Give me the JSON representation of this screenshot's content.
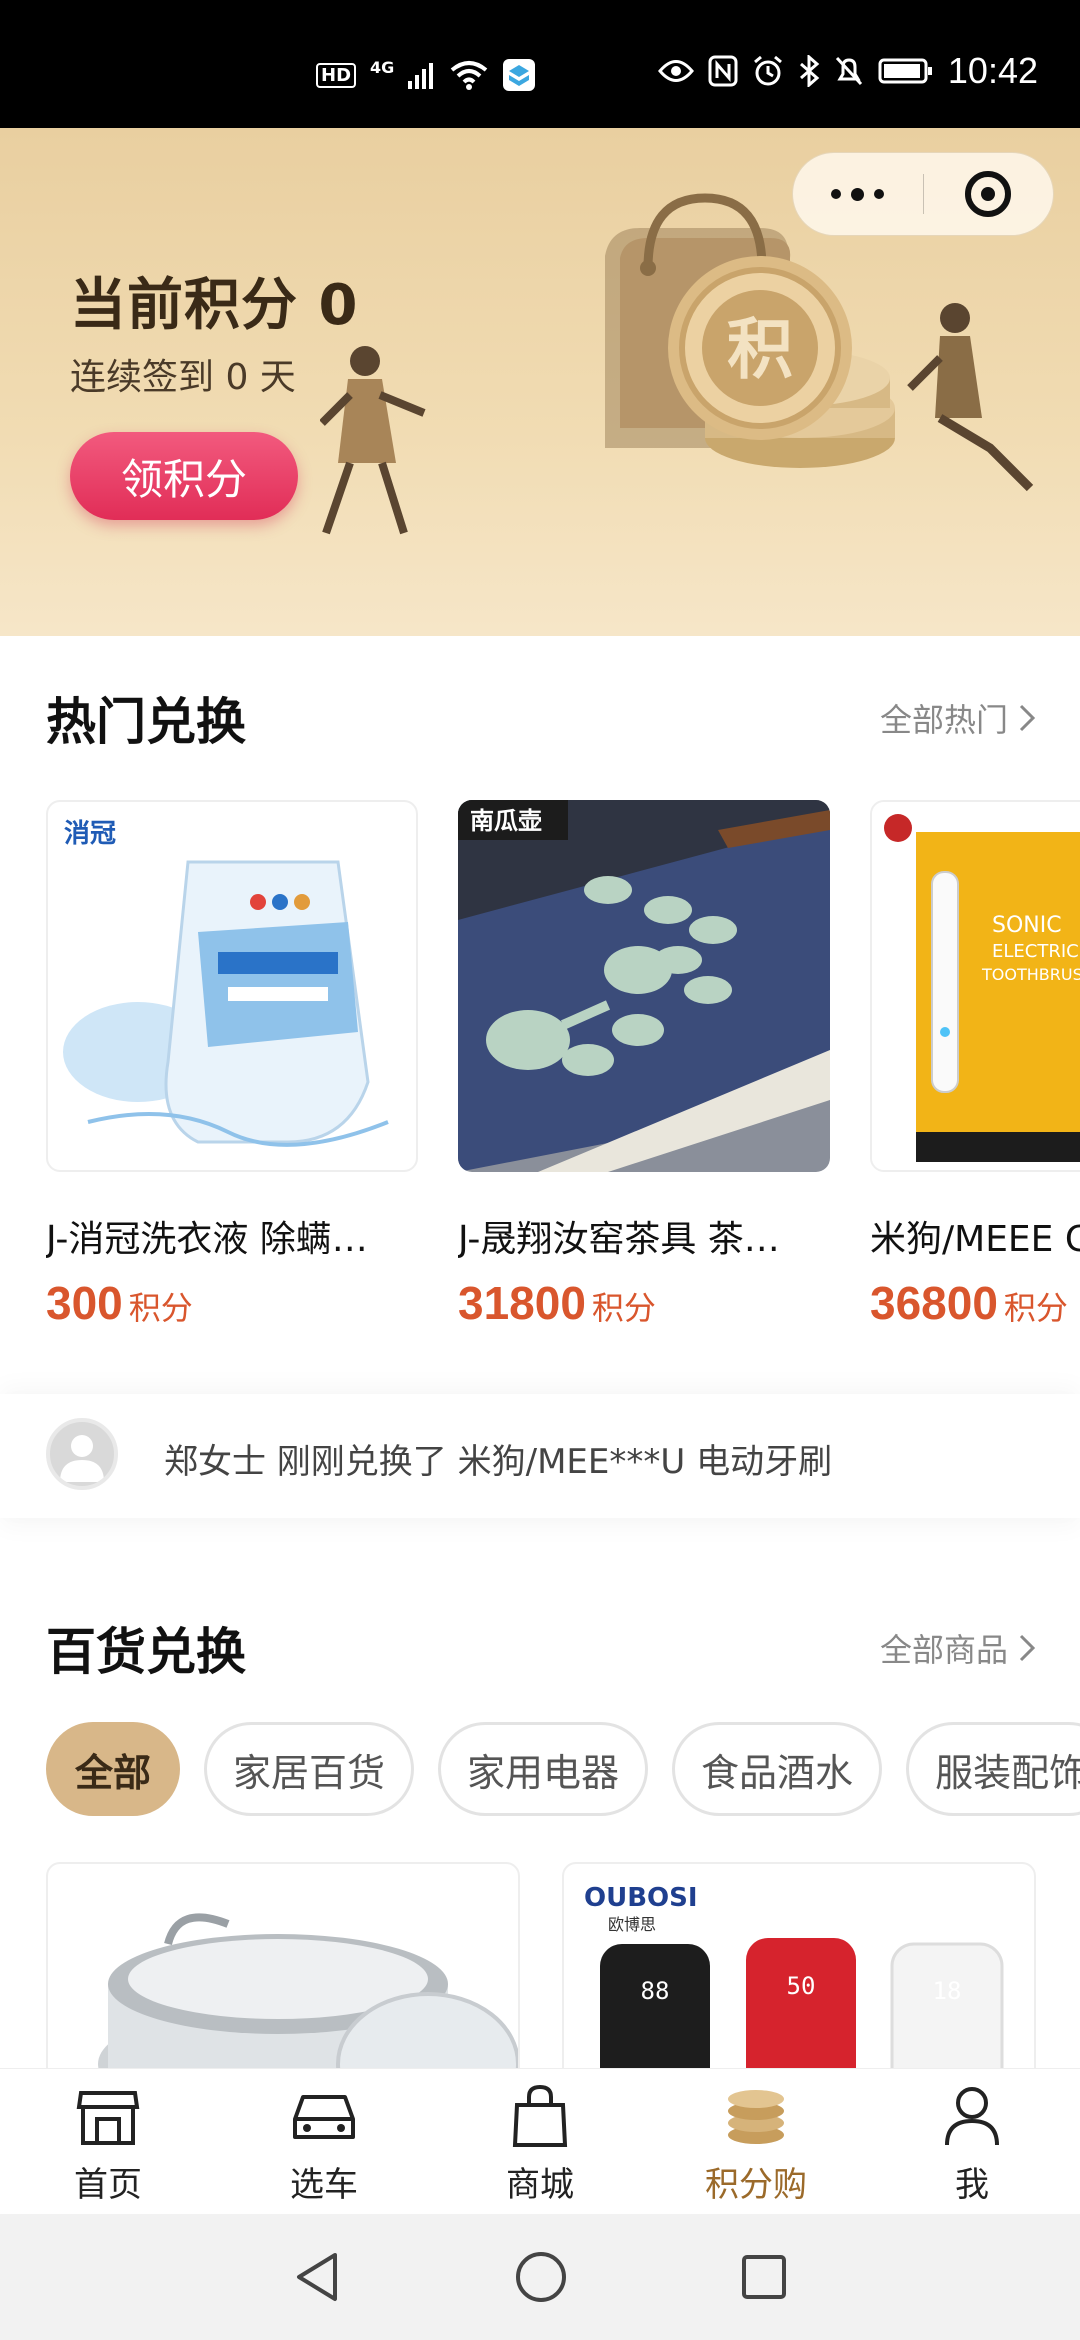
{
  "status_bar": {
    "time": "10:42",
    "network": "4G",
    "hd": "HD"
  },
  "hero": {
    "points_label": "当前积分 0",
    "streak_label": "连续签到 0 天",
    "claim_button": "领积分",
    "coin_char": "积"
  },
  "hot": {
    "title": "热门兑换",
    "more": "全部热门",
    "items": [
      {
        "name": "J-消冠洗衣液 除螨…",
        "price": "300",
        "unit": "积分",
        "brand": "消冠"
      },
      {
        "name": "J-晟翔汝窑茶具 茶…",
        "price": "31800",
        "unit": "积分",
        "brand": "南瓜壶"
      },
      {
        "name": "米狗/MEEE C",
        "price": "36800",
        "unit": "积分",
        "brand": "SONIC ELECTRIC TOOTHBRUSH"
      }
    ]
  },
  "ticker": {
    "text": "郑女士 刚刚兑换了 米狗/MEE***U 电动牙刷"
  },
  "general": {
    "title": "百货兑换",
    "more": "全部商品",
    "chips": [
      "全部",
      "家居百货",
      "家用电器",
      "食品酒水",
      "服装配饰"
    ],
    "goods_brand": "OUBOSI",
    "goods_brand_cn": "欧博思",
    "cup_readings": [
      "88",
      "50",
      "18"
    ]
  },
  "tabbar": {
    "items": [
      "首页",
      "选车",
      "商城",
      "积分购",
      "我"
    ]
  },
  "colors": {
    "accent": "#d9562d",
    "brand_gold": "#d8b789",
    "claim_pink": "#e12d57"
  }
}
